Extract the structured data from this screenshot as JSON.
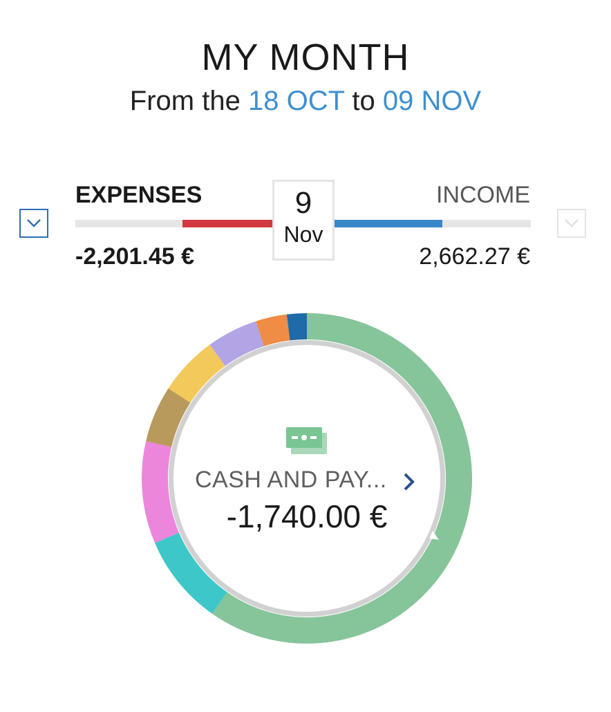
{
  "header": {
    "title": "MY MONTH",
    "subtitle_prefix": "From the",
    "start_date": "18 OCT",
    "subtitle_mid": "to",
    "end_date": "09 NOV"
  },
  "summary": {
    "expenses_label": "EXPENSES",
    "income_label": "INCOME",
    "expenses_amount": "-2,201.45 €",
    "income_amount": "2,662.27 €",
    "selected_day": "9",
    "selected_month": "Nov",
    "expenses_color": "#d0393f",
    "income_color": "#3a87c9"
  },
  "donut": {
    "selected_category": "CASH AND PAY...",
    "selected_amount": "-1,740.00 €",
    "icon": "cash-bills-icon",
    "segments": [
      {
        "color": "#86c49a"
      },
      {
        "color": "#3ec7c9"
      },
      {
        "color": "#ec86dd"
      },
      {
        "color": "#b89a5c"
      },
      {
        "color": "#f2c95a"
      },
      {
        "color": "#b3a4e6"
      },
      {
        "color": "#ef8c45"
      },
      {
        "color": "#1f6aa8"
      }
    ]
  }
}
